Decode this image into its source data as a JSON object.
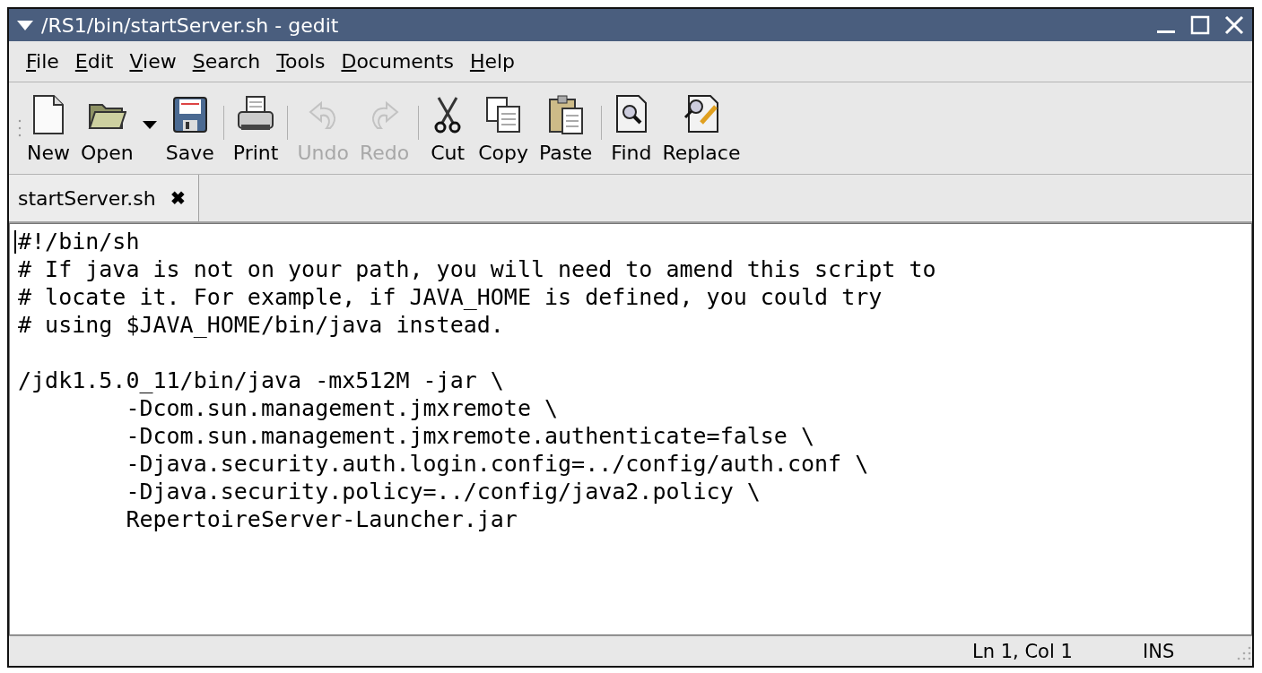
{
  "window": {
    "title": "/RS1/bin/startServer.sh - gedit"
  },
  "menu": [
    {
      "underlined": "F",
      "rest": "ile"
    },
    {
      "underlined": "E",
      "rest": "dit"
    },
    {
      "underlined": "V",
      "rest": "iew"
    },
    {
      "underlined": "S",
      "rest": "earch"
    },
    {
      "underlined": "T",
      "rest": "ools"
    },
    {
      "underlined": "D",
      "rest": "ocuments"
    },
    {
      "underlined": "H",
      "rest": "elp"
    }
  ],
  "toolbar": [
    {
      "kind": "button",
      "label": "New",
      "disabled": false
    },
    {
      "kind": "button",
      "label": "Open",
      "disabled": false
    },
    {
      "kind": "dropdown"
    },
    {
      "kind": "button",
      "label": "Save",
      "disabled": false
    },
    {
      "kind": "separator"
    },
    {
      "kind": "button",
      "label": "Print",
      "disabled": false
    },
    {
      "kind": "separator"
    },
    {
      "kind": "button",
      "label": "Undo",
      "disabled": true
    },
    {
      "kind": "button",
      "label": "Redo",
      "disabled": true
    },
    {
      "kind": "separator"
    },
    {
      "kind": "button",
      "label": "Cut",
      "disabled": false
    },
    {
      "kind": "button",
      "label": "Copy",
      "disabled": false
    },
    {
      "kind": "button",
      "label": "Paste",
      "disabled": false
    },
    {
      "kind": "separator"
    },
    {
      "kind": "button",
      "label": "Find",
      "disabled": false
    },
    {
      "kind": "button",
      "label": "Replace",
      "disabled": false
    }
  ],
  "tabs": [
    {
      "label": "startServer.sh",
      "close": "✖",
      "selected": true
    }
  ],
  "editor": {
    "blocks": [
      [
        "#!/bin/sh",
        "# If java is not on your path, you will need to amend this script to",
        "# locate it. For example, if JAVA_HOME is defined, you could try",
        "# using $JAVA_HOME/bin/java instead."
      ],
      [
        "/jdk1.5.0_11/bin/java -mx512M -jar \\",
        "        -Dcom.sun.management.jmxremote \\",
        "        -Dcom.sun.management.jmxremote.authenticate=false \\",
        "        -Djava.security.auth.login.config=../config/auth.conf \\",
        "        -Djava.security.policy=../config/java2.policy \\",
        "        RepertoireServer-Launcher.jar"
      ]
    ]
  },
  "status_bar": {
    "position": "Ln 1, Col 1",
    "mode": "INS"
  }
}
